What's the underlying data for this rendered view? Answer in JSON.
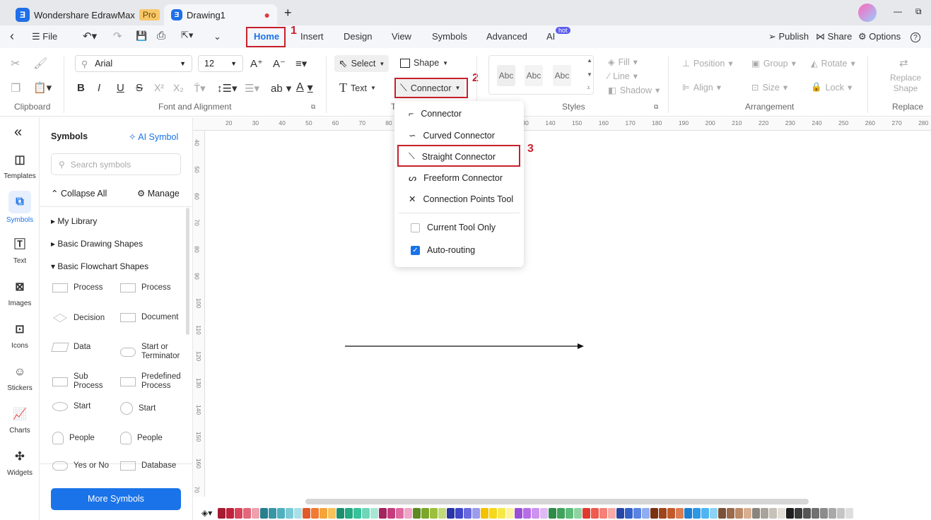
{
  "titlebar": {
    "app_tab": "Wondershare EdrawMax",
    "pro_badge": "Pro",
    "doc_tab": "Drawing1",
    "new_tab": "+",
    "minimize": "—",
    "restore": "⧉"
  },
  "menubar": {
    "back": "‹",
    "file": "File",
    "tabs": [
      "Home",
      "Insert",
      "Design",
      "View",
      "Symbols",
      "Advanced",
      "AI"
    ],
    "hot_badge": "hot",
    "publish": "Publish",
    "share": "Share",
    "options": "Options",
    "help": "?"
  },
  "annotations": [
    "1",
    "2",
    "3"
  ],
  "ribbon": {
    "clipboard": {
      "label": "Clipboard"
    },
    "font": {
      "family": "Arial",
      "size": "12",
      "group_label": "Font and Alignment",
      "bold": "B",
      "italic": "I",
      "underline": "U",
      "strike": "S",
      "sup": "X²",
      "sub": "X₂",
      "ab": "ab",
      "color_a": "A",
      "grow": "A⁺",
      "shrink": "A⁻"
    },
    "tools": {
      "select": "Select",
      "shape": "Shape",
      "text": "Text",
      "connector": "Connector",
      "group_label": "T"
    },
    "styles": {
      "samples": [
        "Abc",
        "Abc",
        "Abc"
      ],
      "fill": "Fill",
      "line": "Line",
      "shadow": "Shadow",
      "group_label": "Styles"
    },
    "arrangement": {
      "position": "Position",
      "group": "Group",
      "rotate": "Rotate",
      "align": "Align",
      "size": "Size",
      "lock": "Lock",
      "group_label": "Arrangement"
    },
    "replace": {
      "button": "Replace Shape",
      "group_label": "Replace"
    }
  },
  "connector_menu": {
    "items": [
      "Connector",
      "Curved Connector",
      "Straight Connector",
      "Freeform Connector",
      "Connection Points Tool"
    ],
    "options": [
      {
        "label": "Current Tool Only",
        "checked": false
      },
      {
        "label": "Auto-routing",
        "checked": true
      }
    ]
  },
  "leftnav": {
    "collapse": "«",
    "items": [
      "Templates",
      "Symbols",
      "Text",
      "Images",
      "Icons",
      "Stickers",
      "Charts",
      "Widgets"
    ],
    "active": "Symbols"
  },
  "panel": {
    "title": "Symbols",
    "ai_symbol": "AI Symbol",
    "search_placeholder": "Search symbols",
    "collapse_all": "Collapse All",
    "manage": "Manage",
    "libraries": [
      "My Library",
      "Basic Drawing Shapes",
      "Basic Flowchart Shapes"
    ],
    "shapes": [
      "Process",
      "Process",
      "Decision",
      "Document",
      "Data",
      "Start or Terminator",
      "Sub Process",
      "Predefined Process",
      "Start",
      "Start",
      "People",
      "People",
      "Yes or No",
      "Database"
    ],
    "more": "More Symbols"
  },
  "rulers": {
    "h": [
      "20",
      "30",
      "40",
      "50",
      "60",
      "70",
      "80",
      "90",
      "100",
      "110",
      "120",
      "130",
      "140",
      "150",
      "160",
      "170",
      "180",
      "190",
      "200",
      "210",
      "220",
      "230",
      "240",
      "250",
      "260",
      "270",
      "280"
    ],
    "v": [
      "40",
      "50",
      "60",
      "70",
      "80",
      "90",
      "100",
      "110",
      "120",
      "130",
      "140",
      "150",
      "160",
      "70"
    ]
  },
  "colors": {
    "accent": "#1a73e8",
    "annotation": "#c8202b",
    "palette": [
      "#a51c30",
      "#c0213a",
      "#d9435a",
      "#e2677b",
      "#f0a1ae",
      "#2a7f8f",
      "#3796a6",
      "#4fb0bf",
      "#7ccad6",
      "#a9e0e8",
      "#e2592a",
      "#f07a32",
      "#f5a43a",
      "#f8c25a",
      "#1e8f6e",
      "#24a982",
      "#37c29b",
      "#6fd6b8",
      "#a7e8d4",
      "#a3245e",
      "#c53c7c",
      "#de6aa0",
      "#f0a6c8",
      "#5c8a1f",
      "#7ba62a",
      "#9dbf3f",
      "#c2d97a",
      "#2a34a6",
      "#3f46c9",
      "#6a6be0",
      "#9c9cee",
      "#f2c200",
      "#f5d81e",
      "#f7e84a",
      "#fbf3a0",
      "#9b4fd6",
      "#b56ee6",
      "#cc93f0",
      "#dfb9f6",
      "#2e8b4a",
      "#3fa35d",
      "#5dbb7a",
      "#8fd3a4",
      "#e03a2f",
      "#ef5a4f",
      "#f48078",
      "#f8aaa5",
      "#2747a6",
      "#3560c9",
      "#5a84e0",
      "#8fadf0",
      "#7a3210",
      "#a0451b",
      "#c25a2b",
      "#db7d52",
      "#1d7fd1",
      "#2c98e6",
      "#4fb5f0",
      "#8cd3f7",
      "#7a5239",
      "#9c6a4c",
      "#bb8a68",
      "#d7b092",
      "#8a857c",
      "#a8a39a",
      "#c7c2b8",
      "#e3dfd6",
      "#1f1f1f",
      "#3a3a3a",
      "#555555",
      "#707070",
      "#8c8c8c",
      "#a8a8a8",
      "#c4c4c4",
      "#dedede"
    ]
  }
}
